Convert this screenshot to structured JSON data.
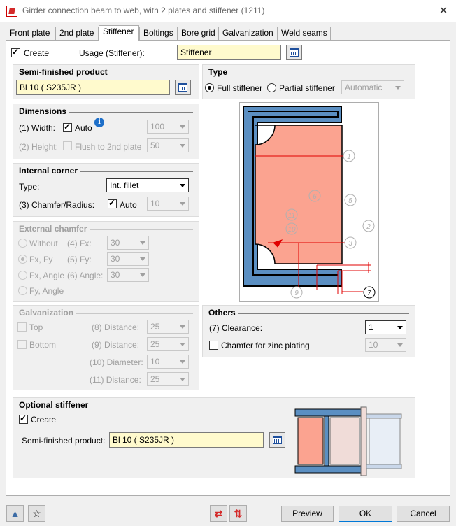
{
  "window": {
    "title": "Girder connection beam to web, with 2 plates and stiffener (1211)"
  },
  "tabs": [
    {
      "label": "Front plate",
      "active": false
    },
    {
      "label": "2nd plate",
      "active": false
    },
    {
      "label": "Stiffener",
      "active": true
    },
    {
      "label": "Boltings",
      "active": false
    },
    {
      "label": "Bore grid",
      "active": false
    },
    {
      "label": "Galvanization",
      "active": false
    },
    {
      "label": "Weld seams",
      "active": false
    }
  ],
  "top": {
    "create_label": "Create",
    "create_checked": true,
    "usage_label": "Usage (Stiffener):",
    "usage_value": "Stiffener"
  },
  "semi": {
    "title": "Semi-finished product",
    "value": "Bl 10  ( S235JR )"
  },
  "type": {
    "title": "Type",
    "full_label": "Full stiffener",
    "partial_label": "Partial stiffener",
    "selected": "Full stiffener",
    "mode_value": "Automatic"
  },
  "dimensions": {
    "title": "Dimensions",
    "width_label": "(1) Width:",
    "width_auto_label": "Auto",
    "width_auto_checked": true,
    "width_value": "100",
    "height_label": "(2) Height:",
    "height_flush_label": "Flush to 2nd plate",
    "height_flush_checked": false,
    "height_value": "50"
  },
  "internal_corner": {
    "title": "Internal corner",
    "type_label": "Type:",
    "type_value": "Int. fillet",
    "chamfer_label": "(3) Chamfer/Radius:",
    "chamfer_auto_label": "Auto",
    "chamfer_auto_checked": true,
    "chamfer_value": "10"
  },
  "external_chamfer": {
    "title": "External chamfer",
    "opt_without": "Without",
    "opt_fxfy": "Fx, Fy",
    "opt_fxangle": "Fx, Angle",
    "opt_fyangle": "Fy, Angle",
    "selected": "Fx, Fy",
    "fx_label": "(4) Fx:",
    "fx_value": "30",
    "fy_label": "(5) Fy:",
    "fy_value": "30",
    "angle_label": "(6) Angle:",
    "angle_value": "30"
  },
  "galvanization": {
    "title": "Galvanization",
    "top_label": "Top",
    "bottom_label": "Bottom",
    "d8_label": "(8) Distance:",
    "d8_value": "25",
    "d9_label": "(9) Distance:",
    "d9_value": "25",
    "d10_label": "(10) Diameter:",
    "d10_value": "10",
    "d11_label": "(11) Distance:",
    "d11_value": "25"
  },
  "others": {
    "title": "Others",
    "clearance_label": "(7) Clearance:",
    "clearance_value": "1",
    "chamfer_zinc_label": "Chamfer for zinc plating",
    "chamfer_zinc_checked": false,
    "chamfer_zinc_value": "10"
  },
  "optional": {
    "title": "Optional stiffener",
    "create_label": "Create",
    "create_checked": true,
    "semi_label": "Semi-finished product:",
    "semi_value": "Bl 10  ( S235JR )"
  },
  "diagram": {
    "callouts": [
      "1",
      "2",
      "3",
      "5",
      "6",
      "7",
      "9",
      "10",
      "11"
    ]
  },
  "buttons": {
    "preview": "Preview",
    "ok": "OK",
    "cancel": "Cancel"
  },
  "colors": {
    "stiffener_fill": "#fba390",
    "beam_blue": "#5b8fc2",
    "dimension_red": "#e00000",
    "input_yellow": "#fffacd"
  }
}
